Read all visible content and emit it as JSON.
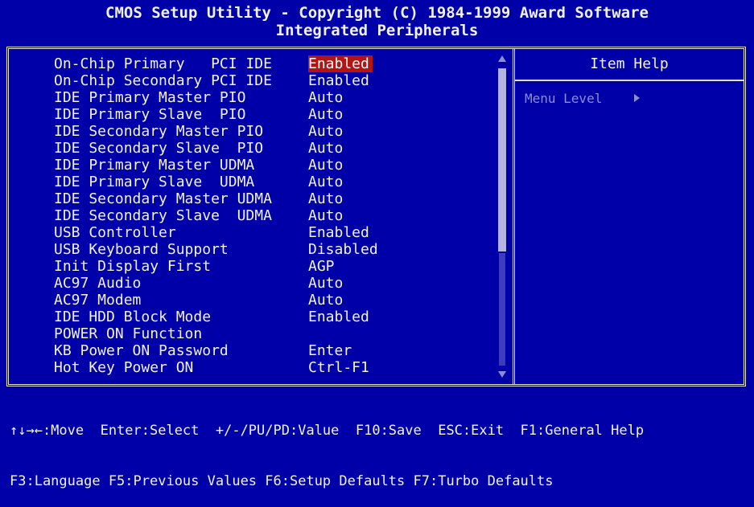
{
  "header": {
    "line1": "CMOS Setup Utility - Copyright (C) 1984-1999 Award Software",
    "line2": "Integrated Peripherals"
  },
  "settings": [
    {
      "label": "On-Chip Primary   PCI IDE",
      "value": "Enabled"
    },
    {
      "label": "On-Chip Secondary PCI IDE",
      "value": "Enabled"
    },
    {
      "label": "IDE Primary Master PIO",
      "value": "Auto"
    },
    {
      "label": "IDE Primary Slave  PIO",
      "value": "Auto"
    },
    {
      "label": "IDE Secondary Master PIO",
      "value": "Auto"
    },
    {
      "label": "IDE Secondary Slave  PIO",
      "value": "Auto"
    },
    {
      "label": "IDE Primary Master UDMA",
      "value": "Auto"
    },
    {
      "label": "IDE Primary Slave  UDMA",
      "value": "Auto"
    },
    {
      "label": "IDE Secondary Master UDMA",
      "value": "Auto"
    },
    {
      "label": "IDE Secondary Slave  UDMA",
      "value": "Auto"
    },
    {
      "label": "USB Controller",
      "value": "Enabled"
    },
    {
      "label": "USB Keyboard Support",
      "value": "Disabled"
    },
    {
      "label": "Init Display First",
      "value": "AGP"
    },
    {
      "label": "AC97 Audio",
      "value": "Auto"
    },
    {
      "label": "AC97 Modem",
      "value": "Auto"
    },
    {
      "label": "IDE HDD Block Mode",
      "value": "Enabled"
    },
    {
      "label": "POWER ON Function",
      "value": ""
    },
    {
      "label": "KB Power ON Password",
      "value": "Enter"
    },
    {
      "label": "Hot Key Power ON",
      "value": "Ctrl-F1"
    }
  ],
  "help_panel": {
    "title": "Item Help",
    "menu_level": "Menu Level"
  },
  "footer": {
    "line1": "↑↓→←:Move  Enter:Select  +/-/PU/PD:Value  F10:Save  ESC:Exit  F1:General Help",
    "line2": "F3:Language F5:Previous Values F6:Setup Defaults F7:Turbo Defaults"
  },
  "colors": {
    "background": "#0000a8",
    "selected_highlight": "#b41414",
    "text": "#f2f2f2",
    "dim_text": "#8c8cd8"
  }
}
